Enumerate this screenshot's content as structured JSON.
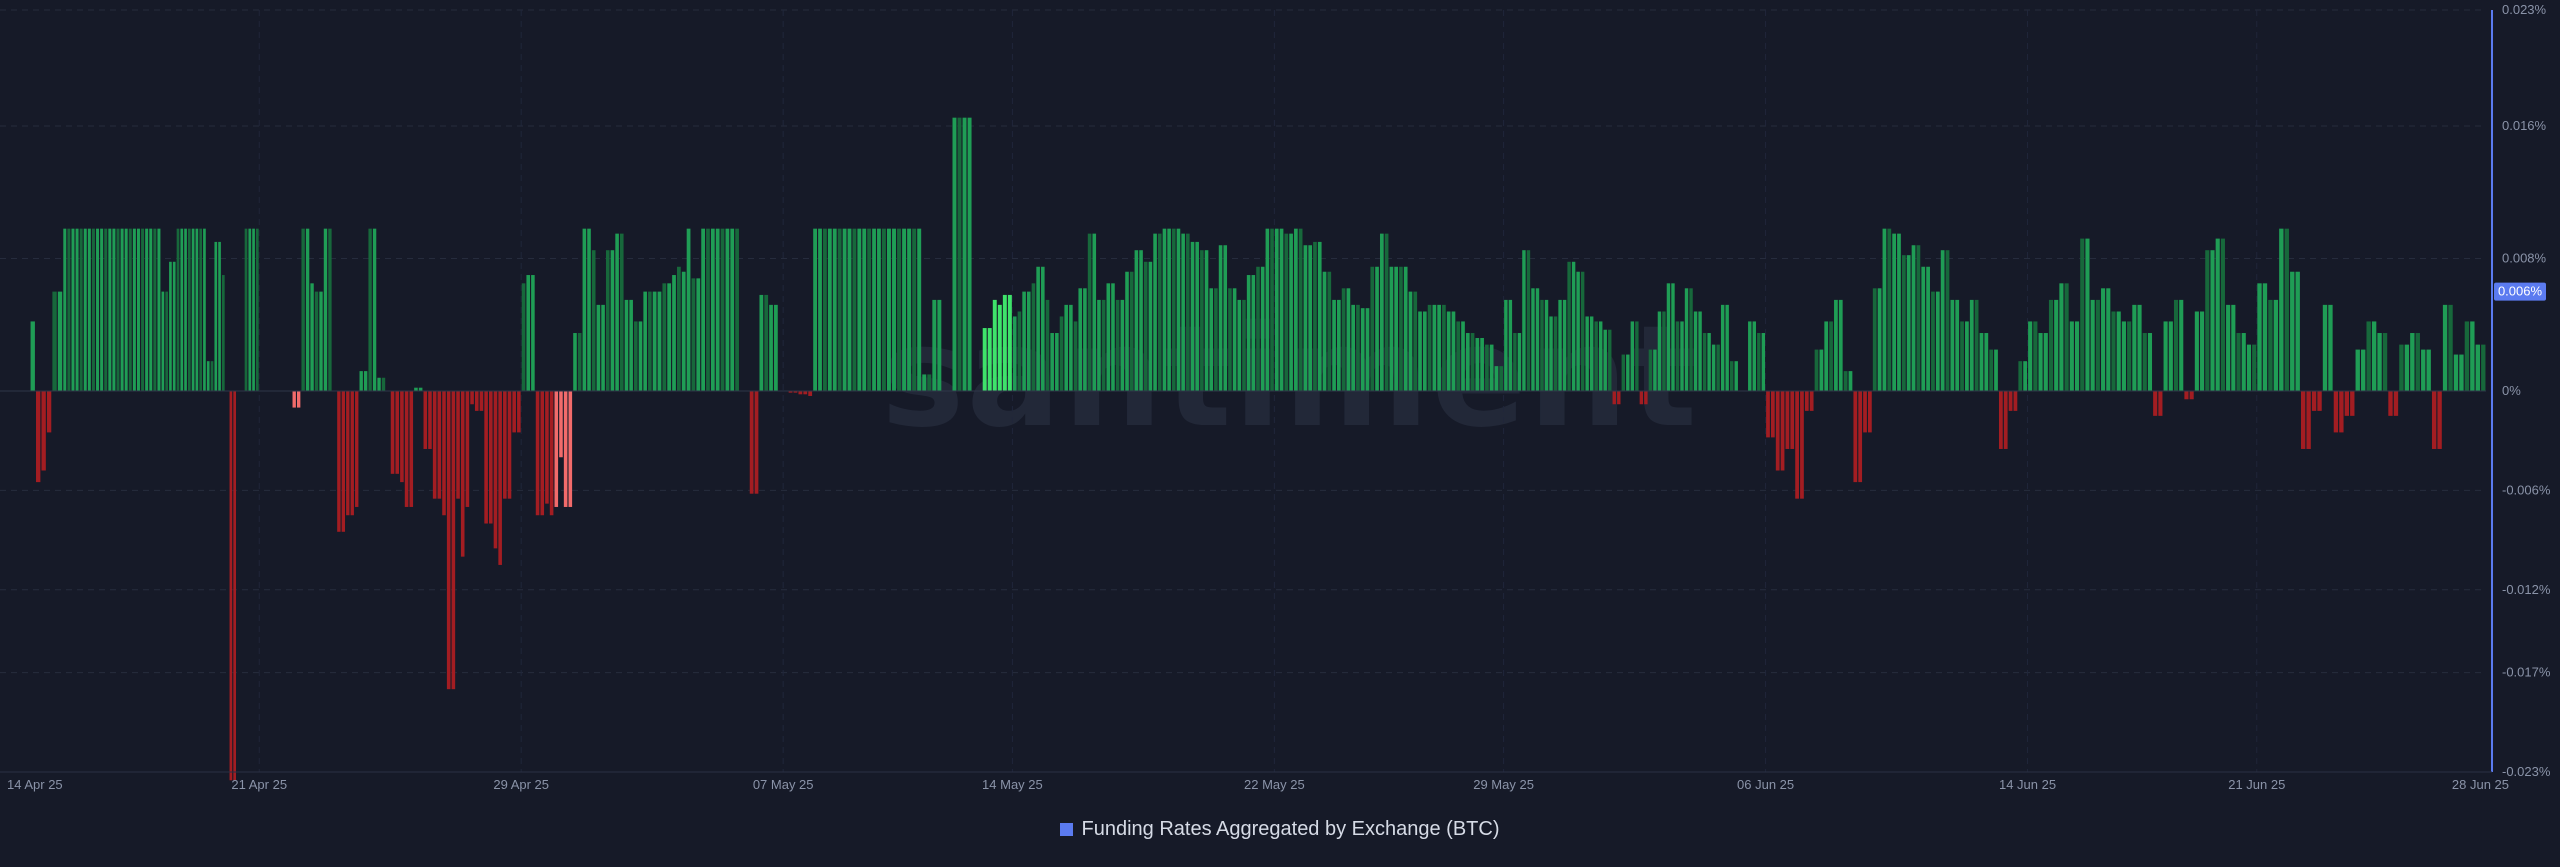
{
  "chart_data": {
    "type": "bar",
    "legend": {
      "label": "Funding Rates Aggregated by Exchange (BTC)",
      "position": "bottom-center",
      "swatch_color": "#5b7bf0"
    },
    "watermark": "santiment",
    "y_axis": {
      "position": "right",
      "ticks": [
        "0.023%",
        "0.016%",
        "0.008%",
        "0%",
        "-0.006%",
        "-0.012%",
        "-0.017%",
        "-0.023%"
      ],
      "tick_values": [
        0.023,
        0.016,
        0.008,
        0,
        -0.006,
        -0.012,
        -0.017,
        -0.023
      ],
      "range": [
        -0.023,
        0.023
      ],
      "current_value_label": "0.006%",
      "current_value": 0.006
    },
    "x_axis": {
      "ticks": [
        "14 Apr 25",
        "21 Apr 25",
        "29 Apr 25",
        "07 May 25",
        "14 May 25",
        "22 May 25",
        "29 May 25",
        "06 Jun 25",
        "14 Jun 25",
        "21 Jun 25",
        "28 Jun 25"
      ],
      "range": [
        "14 Apr 25",
        "28 Jun 25"
      ]
    },
    "grid": true,
    "colors": {
      "positive": "#1f9d55",
      "positive_dim": "#17683b",
      "negative": "#a31d22",
      "highlight_positive": "#3ee36a",
      "highlight_negative": "#f26b6b",
      "axis_line": "#5b7bf0",
      "badge": "#5b7bf0"
    },
    "segments": [
      {
        "from": "14 Apr 25",
        "to": "15 Apr 25",
        "values": [
          0.0042,
          -0.0055,
          -0.0048,
          -0.0025,
          0.006,
          0.006
        ]
      },
      {
        "from": "15 Apr 25",
        "to": "18 Apr 25",
        "values": [
          0.0098,
          0.0098,
          0.0098,
          0.0098,
          0.0098,
          0.0098,
          0.0098,
          0.0098,
          0.0098,
          0.0098,
          0.0098,
          0.0098,
          0.0098,
          0.0098,
          0.0098,
          0.0098,
          0.0098,
          0.0098,
          0.0098,
          0.0098,
          0.0098,
          0.0098,
          0.0098,
          0.0098
        ]
      },
      {
        "from": "18 Apr 25",
        "to": "21 Apr 25",
        "values": [
          0.006,
          0.006,
          0.0078,
          0.0078,
          0.0098,
          0.0098,
          0.0098,
          0.0098,
          0.0098,
          0.0098,
          0.0098,
          0.0098,
          0.0018,
          0.0018,
          0.009,
          0.009,
          0.007,
          0.0,
          -0.0235,
          -0.0235,
          0.0,
          0.0,
          0.0098,
          0.0098,
          0.0098,
          0.0098
        ]
      },
      {
        "from": "22 Apr 25",
        "to": "25 Apr 25",
        "values": [
          -0.001,
          -0.001,
          0.0098,
          0.0098,
          0.0065,
          0.006,
          0.006,
          0.0098,
          0.0098,
          0.0,
          -0.0085,
          -0.0085,
          -0.0075,
          -0.0075,
          -0.007,
          0.0012,
          0.0012,
          0.0098,
          0.0098,
          0.0008,
          0.0008,
          0.0
        ]
      },
      {
        "from": "25 Apr 25",
        "to": "29 Apr 25",
        "values": [
          -0.005,
          -0.005,
          -0.0055,
          -0.007,
          -0.007,
          0.0002,
          0.0002,
          -0.0035,
          -0.0035,
          -0.0065,
          -0.0065,
          -0.0075,
          -0.018,
          -0.018,
          -0.0065,
          -0.01,
          -0.007,
          -0.0008,
          -0.0012,
          -0.0012,
          -0.008,
          -0.008,
          -0.0095,
          -0.0105,
          -0.0065,
          -0.0065,
          -0.0025,
          -0.0025
        ]
      },
      {
        "from": "29 Apr 25",
        "to": "03 May 25",
        "values": [
          0.0065,
          0.007,
          0.007,
          -0.0075,
          -0.0075,
          -0.0068,
          -0.0075,
          -0.007,
          -0.004,
          -0.007,
          -0.007,
          0.0035,
          0.0035,
          0.0098,
          0.0098,
          0.0085,
          0.0052,
          0.0052,
          0.0085,
          0.0085,
          0.0095,
          0.0095,
          0.0055,
          0.0055,
          0.0042,
          0.0042,
          0.006,
          0.006
        ]
      },
      {
        "from": "03 May 25",
        "to": "07 May 25",
        "values": [
          0.006,
          0.006,
          0.0065,
          0.0065,
          0.007,
          0.0075,
          0.0072,
          0.0098,
          0.0068,
          0.0068,
          0.0098,
          0.0098,
          0.0098,
          0.0098,
          0.0098,
          0.0098,
          0.0098,
          0.0098,
          0.0,
          0.0,
          -0.0062,
          -0.0062,
          0.0058,
          0.0058,
          0.0052,
          0.0052,
          0.0
        ]
      },
      {
        "from": "07 May 25",
        "to": "10 May 25",
        "values": [
          0.0,
          -0.0001,
          -0.0001,
          -0.0002,
          -0.0002,
          -0.0003,
          0.0098,
          0.0098,
          0.0098,
          0.0098,
          0.0098,
          0.0098,
          0.0098,
          0.0098,
          0.0098,
          0.0098,
          0.0098,
          0.0098,
          0.0098,
          0.0098
        ]
      },
      {
        "from": "10 May 25",
        "to": "14 May 25",
        "values": [
          0.0098,
          0.0098,
          0.0098,
          0.0098,
          0.0098,
          0.0098,
          0.0098,
          0.0098,
          0.001,
          0.001,
          0.0055,
          0.0055,
          0.0,
          0.0,
          0.0165,
          0.0165,
          0.0165,
          0.0165,
          0.0,
          0.0,
          0.0038,
          0.0038,
          0.0055,
          0.0052,
          0.0058,
          0.0058
        ]
      },
      {
        "from": "14 May 25",
        "to": "22 May 25",
        "values": [
          0.0045,
          0.0048,
          0.006,
          0.006,
          0.0065,
          0.0075,
          0.0075,
          0.0055,
          0.0035,
          0.0035,
          0.0045,
          0.0052,
          0.0052,
          0.0042,
          0.0062,
          0.0062,
          0.0095,
          0.0095,
          0.0055,
          0.0055,
          0.0065,
          0.0065,
          0.0055,
          0.0055,
          0.0072,
          0.0072,
          0.0085,
          0.0085,
          0.0078,
          0.0078,
          0.0095,
          0.0095,
          0.0098,
          0.0098,
          0.0098,
          0.0098,
          0.0095,
          0.0095,
          0.009,
          0.009,
          0.0085,
          0.0085,
          0.0062,
          0.0062,
          0.0088,
          0.0088,
          0.0062,
          0.0062,
          0.0055,
          0.0055,
          0.007,
          0.007,
          0.0075,
          0.0075,
          0.0098,
          0.0098
        ]
      },
      {
        "from": "22 May 25",
        "to": "29 May 25",
        "values": [
          0.0098,
          0.0098,
          0.0095,
          0.0095,
          0.0098,
          0.0098,
          0.0088,
          0.0088,
          0.009,
          0.009,
          0.0072,
          0.0072,
          0.0055,
          0.0055,
          0.0062,
          0.0062,
          0.0052,
          0.0052,
          0.005,
          0.005,
          0.0075,
          0.0075,
          0.0095,
          0.0095,
          0.0075,
          0.0075,
          0.0075,
          0.0075,
          0.006,
          0.006,
          0.0048,
          0.0048,
          0.0052,
          0.0052,
          0.0052,
          0.0052,
          0.0048,
          0.0048,
          0.0042,
          0.0042,
          0.0035,
          0.0035,
          0.0032,
          0.0032,
          0.0028,
          0.0028,
          0.0015,
          0.0015
        ]
      },
      {
        "from": "29 May 25",
        "to": "06 Jun 25",
        "values": [
          0.0055,
          0.0055,
          0.0035,
          0.0035,
          0.0085,
          0.0085,
          0.0062,
          0.0062,
          0.0055,
          0.0055,
          0.0045,
          0.0045,
          0.0055,
          0.0055,
          0.0078,
          0.0078,
          0.0072,
          0.0072,
          0.0045,
          0.0045,
          0.0042,
          0.0042,
          0.0037,
          0.0037,
          -0.0008,
          -0.0008,
          0.0022,
          0.0022,
          0.0042,
          0.0042,
          -0.0008,
          -0.0008,
          0.0025,
          0.0025,
          0.0048,
          0.0048,
          0.0065,
          0.0065,
          0.0042,
          0.0042,
          0.0062,
          0.0062,
          0.0048,
          0.0048,
          0.0035,
          0.0035,
          0.0028,
          0.0028,
          0.0052,
          0.0052,
          0.0018,
          0.0018,
          0.0,
          0.0,
          0.0042,
          0.0042,
          0.0035,
          0.0035
        ]
      },
      {
        "from": "06 Jun 25",
        "to": "14 Jun 25",
        "values": [
          -0.0028,
          -0.0028,
          -0.0048,
          -0.0048,
          -0.0035,
          -0.0035,
          -0.0065,
          -0.0065,
          -0.0012,
          -0.0012,
          0.0025,
          0.0025,
          0.0042,
          0.0042,
          0.0055,
          0.0055,
          0.0012,
          0.0012,
          -0.0055,
          -0.0055,
          -0.0025,
          -0.0025,
          0.0062,
          0.0062,
          0.0098,
          0.0098,
          0.0095,
          0.0095,
          0.0082,
          0.0082,
          0.0088,
          0.0088,
          0.0075,
          0.0075,
          0.006,
          0.006,
          0.0085,
          0.0085,
          0.0055,
          0.0055,
          0.0042,
          0.0042,
          0.0055,
          0.0055,
          0.0035,
          0.0035,
          0.0025,
          0.0025,
          -0.0035,
          -0.0035,
          -0.0012,
          -0.0012,
          0.0018,
          0.0018
        ]
      },
      {
        "from": "14 Jun 25",
        "to": "21 Jun 25",
        "values": [
          0.0042,
          0.0042,
          0.0035,
          0.0035,
          0.0055,
          0.0055,
          0.0065,
          0.0065,
          0.0042,
          0.0042,
          0.0092,
          0.0092,
          0.0055,
          0.0055,
          0.0062,
          0.0062,
          0.0048,
          0.0048,
          0.0042,
          0.0042,
          0.0052,
          0.0052,
          0.0035,
          0.0035,
          -0.0015,
          -0.0015,
          0.0042,
          0.0042,
          0.0055,
          0.0055,
          -0.0005,
          -0.0005,
          0.0048,
          0.0048,
          0.0085,
          0.0085,
          0.0092,
          0.0092,
          0.0052,
          0.0052,
          0.0035,
          0.0035,
          0.0028,
          0.0028
        ]
      },
      {
        "from": "21 Jun 25",
        "to": "28 Jun 25",
        "values": [
          0.0065,
          0.0065,
          0.0055,
          0.0055,
          0.0098,
          0.0098,
          0.0072,
          0.0072,
          -0.0035,
          -0.0035,
          -0.0012,
          -0.0012,
          0.0052,
          0.0052,
          -0.0025,
          -0.0025,
          -0.0015,
          -0.0015,
          0.0025,
          0.0025,
          0.0042,
          0.0042,
          0.0035,
          0.0035,
          -0.0015,
          -0.0015,
          0.0028,
          0.0028,
          0.0035,
          0.0035,
          0.0025,
          0.0025,
          -0.0035,
          -0.0035,
          0.0052,
          0.0052,
          0.0022,
          0.0022,
          0.0042,
          0.0042,
          0.0028,
          0.0028
        ]
      }
    ],
    "highlight_ranges": [
      {
        "from": "22 Apr 25",
        "to": "23 Apr 25",
        "tone": "negative"
      },
      {
        "from": "30 Apr 25",
        "to": "01 May 25",
        "tone": "negative"
      },
      {
        "from": "13 May 25",
        "to": "14 May 25",
        "tone": "positive"
      }
    ]
  }
}
